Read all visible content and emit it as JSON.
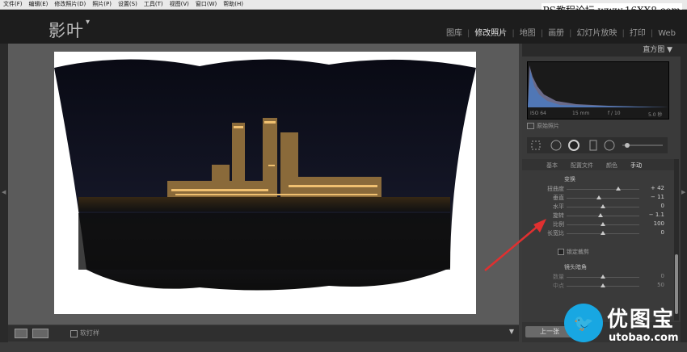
{
  "menu": [
    "文件(F)",
    "编辑(E)",
    "修改照片(D)",
    "照片(P)",
    "设置(S)",
    "工具(T)",
    "视图(V)",
    "窗口(W)",
    "帮助(H)"
  ],
  "watermark": "PS教程论坛 www.16XX8.com",
  "brand": {
    "name": "影叶",
    "caret": "▾"
  },
  "modules": [
    {
      "label": "图库",
      "active": false
    },
    {
      "label": "修改照片",
      "active": true
    },
    {
      "label": "地图",
      "active": false
    },
    {
      "label": "画册",
      "active": false
    },
    {
      "label": "幻灯片放映",
      "active": false
    },
    {
      "label": "打印",
      "active": false
    },
    {
      "label": "Web",
      "active": false
    }
  ],
  "histogram": {
    "title": "直方图",
    "iso": "ISO 64",
    "focal": "15 mm",
    "aperture": "f / 10",
    "shutter": "5.0 秒",
    "original_label": "原始照片"
  },
  "tabs": [
    {
      "label": "基本",
      "active": false
    },
    {
      "label": "配置文件",
      "active": false
    },
    {
      "label": "颜色",
      "active": false
    },
    {
      "label": "手动",
      "active": true
    }
  ],
  "transform": {
    "title": "变换",
    "sliders": [
      {
        "label": "扭曲度",
        "value": "+ 42",
        "pos": 0.71
      },
      {
        "label": "垂直",
        "value": "− 11",
        "pos": 0.44
      },
      {
        "label": "水平",
        "value": "0",
        "pos": 0.5
      },
      {
        "label": "旋转",
        "value": "− 1.1",
        "pos": 0.47
      },
      {
        "label": "比例",
        "value": "100",
        "pos": 0.5
      },
      {
        "label": "长宽比",
        "value": "0",
        "pos": 0.5
      }
    ],
    "lock_label": "锁定裁剪"
  },
  "vignette": {
    "title": "镜头暗角",
    "sliders": [
      {
        "label": "数量",
        "value": "0",
        "pos": 0.5
      },
      {
        "label": "中点",
        "value": "50",
        "pos": 0.5
      }
    ]
  },
  "bottombar": {
    "label": "软打样"
  },
  "footer": {
    "prev_label": "上一张"
  },
  "logo": {
    "text": "优图宝",
    "url": "utobao.com"
  }
}
